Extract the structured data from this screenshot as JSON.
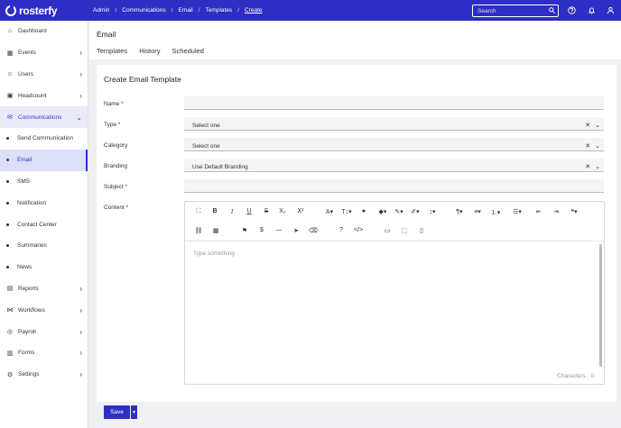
{
  "app": {
    "logo_text": "rosterfy"
  },
  "breadcrumbs": [
    "Admin",
    "Communications",
    "Email",
    "Templates",
    "Create"
  ],
  "search": {
    "placeholder": "Search"
  },
  "sidebar": {
    "items": [
      {
        "label": "Dashboard",
        "icon": "home-icon"
      },
      {
        "label": "Events",
        "icon": "calendar-icon"
      },
      {
        "label": "Users",
        "icon": "users-icon"
      },
      {
        "label": "Headcount",
        "icon": "headcount-icon"
      },
      {
        "label": "Communications",
        "icon": "mail-icon"
      },
      {
        "label": "Send Communication"
      },
      {
        "label": "Email"
      },
      {
        "label": "SMS"
      },
      {
        "label": "Notification"
      },
      {
        "label": "Contact Center"
      },
      {
        "label": "Summaries"
      },
      {
        "label": "News"
      },
      {
        "label": "Reports",
        "icon": "report-icon"
      },
      {
        "label": "Workflows",
        "icon": "workflow-icon"
      },
      {
        "label": "Payroll",
        "icon": "payroll-icon"
      },
      {
        "label": "Forms",
        "icon": "forms-icon"
      },
      {
        "label": "Settings",
        "icon": "gear-icon"
      }
    ]
  },
  "page": {
    "title": "Email",
    "tabs": [
      "Templates",
      "History",
      "Scheduled"
    ]
  },
  "form": {
    "title": "Create Email Template",
    "name_label": "Name",
    "type_label": "Type",
    "type_value": "Select one",
    "category_label": "Category",
    "category_value": "Select one",
    "branding_label": "Branding",
    "branding_value": "Use Default Branding",
    "subject_label": "Subject",
    "content_label": "Content",
    "required_mark": "*",
    "editor_placeholder": "Type something",
    "characters_text": "Characters : 0"
  },
  "footer": {
    "save_label": "Save"
  },
  "colors": {
    "brand": "#2e2ec4",
    "active_bg": "#dcdff7"
  }
}
